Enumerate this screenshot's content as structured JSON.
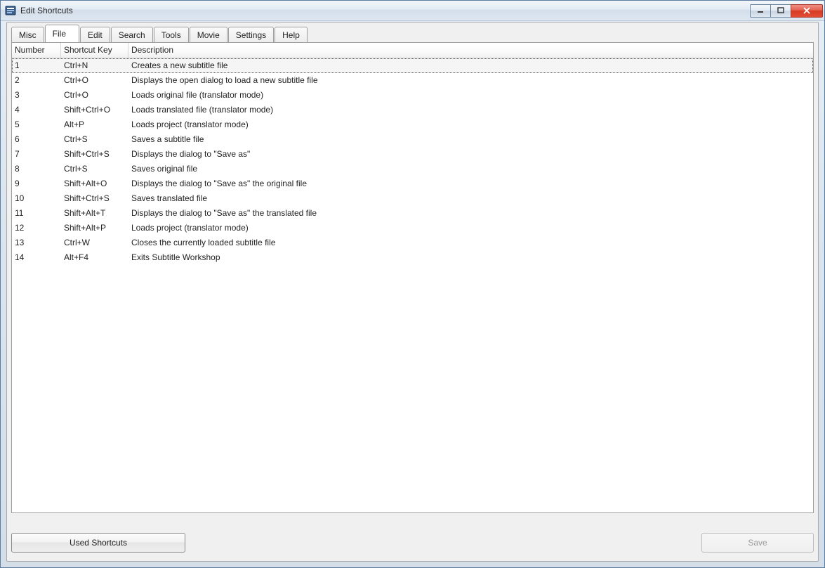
{
  "window": {
    "title": "Edit Shortcuts"
  },
  "tabs": [
    {
      "label": "Misc",
      "active": false
    },
    {
      "label": "File",
      "active": true
    },
    {
      "label": "Edit",
      "active": false
    },
    {
      "label": "Search",
      "active": false
    },
    {
      "label": "Tools",
      "active": false
    },
    {
      "label": "Movie",
      "active": false
    },
    {
      "label": "Settings",
      "active": false
    },
    {
      "label": "Help",
      "active": false
    }
  ],
  "table": {
    "headers": {
      "number": "Number",
      "shortcut_key": "Shortcut Key",
      "description": "Description"
    },
    "rows": [
      {
        "number": "1",
        "key": "Ctrl+N",
        "desc": "Creates a new subtitle file",
        "selected": true
      },
      {
        "number": "2",
        "key": "Ctrl+O",
        "desc": "Displays the open dialog to load a new subtitle file"
      },
      {
        "number": "3",
        "key": "Ctrl+O",
        "desc": "Loads original file (translator mode)"
      },
      {
        "number": "4",
        "key": "Shift+Ctrl+O",
        "desc": "Loads translated file (translator mode)"
      },
      {
        "number": "5",
        "key": "Alt+P",
        "desc": "Loads project (translator mode)"
      },
      {
        "number": "6",
        "key": "Ctrl+S",
        "desc": "Saves a subtitle file"
      },
      {
        "number": "7",
        "key": "Shift+Ctrl+S",
        "desc": "Displays the dialog to \"Save as\""
      },
      {
        "number": "8",
        "key": "Ctrl+S",
        "desc": "Saves original file"
      },
      {
        "number": "9",
        "key": "Shift+Alt+O",
        "desc": "Displays the dialog to \"Save as\" the original file"
      },
      {
        "number": "10",
        "key": "Shift+Ctrl+S",
        "desc": "Saves translated file"
      },
      {
        "number": "11",
        "key": "Shift+Alt+T",
        "desc": "Displays the dialog to \"Save as\" the translated file"
      },
      {
        "number": "12",
        "key": "Shift+Alt+P",
        "desc": "Loads project (translator mode)"
      },
      {
        "number": "13",
        "key": "Ctrl+W",
        "desc": "Closes the currently loaded subtitle file"
      },
      {
        "number": "14",
        "key": "Alt+F4",
        "desc": "Exits Subtitle Workshop"
      }
    ]
  },
  "buttons": {
    "used_shortcuts": "Used Shortcuts",
    "save": "Save"
  }
}
